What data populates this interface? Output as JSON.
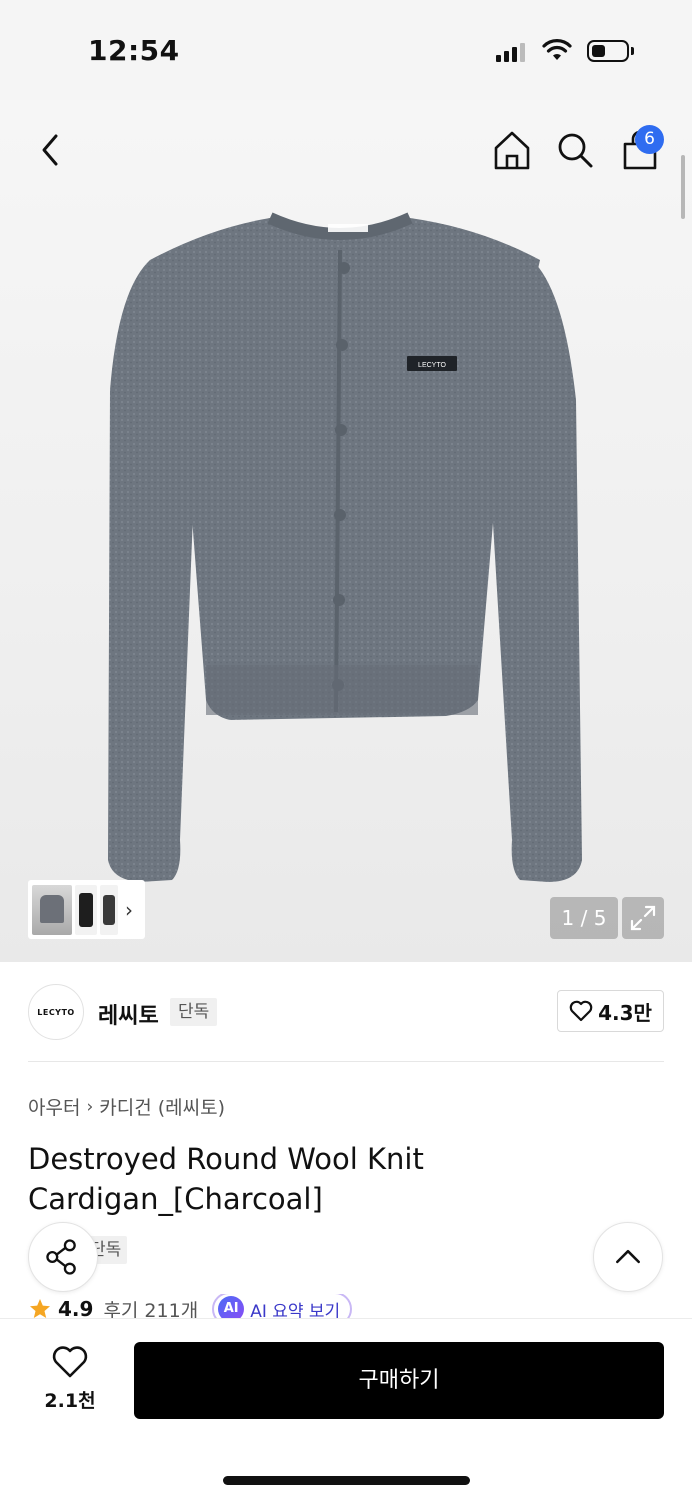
{
  "status_bar": {
    "time": "12:54"
  },
  "cart": {
    "badge_count": "6"
  },
  "gallery": {
    "counter": "1 / 5",
    "current": 1,
    "total": 5
  },
  "brand": {
    "logo_text": "LECYTO",
    "name": "레씨토",
    "tag": "단독",
    "likes": "4.3만"
  },
  "product": {
    "breadcrumb": [
      "아우터",
      "카디건 (레씨토)"
    ],
    "title": "Destroyed Round Wool Knit Cardigan_[Charcoal]",
    "tag": "단독",
    "rating": "4.9",
    "reviews": "후기 211개",
    "ai_summary": "AI 요약 보기",
    "ai_badge": "AI"
  },
  "bottom": {
    "wish_count": "2.1천",
    "buy_label": "구매하기"
  },
  "colors": {
    "accent": "#2f6cf0",
    "buy_bg": "#000000",
    "star": "#f5a623",
    "ai": "#3b39c9"
  },
  "icons": [
    "back-icon",
    "home-icon",
    "search-icon",
    "bag-icon",
    "expand-icon",
    "heart-icon",
    "share-icon",
    "chevron-up-icon",
    "star-icon"
  ]
}
